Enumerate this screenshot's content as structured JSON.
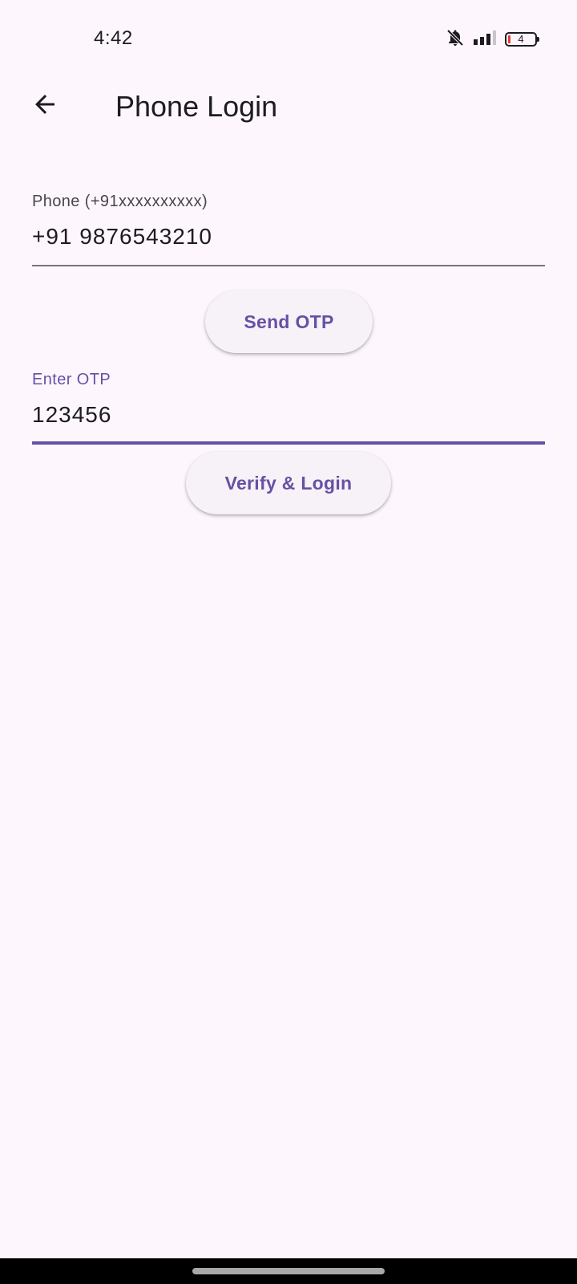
{
  "status_bar": {
    "time": "4:42",
    "battery_level": "4",
    "icons": [
      "notifications-off-icon",
      "signal-icon",
      "battery-icon"
    ]
  },
  "app_bar": {
    "title": "Phone Login",
    "back_icon": "arrow-back-icon"
  },
  "phone_field": {
    "label": "Phone (+91xxxxxxxxxx)",
    "value": "+91 9876543210"
  },
  "send_otp_button": {
    "label": "Send OTP"
  },
  "otp_field": {
    "label": "Enter OTP",
    "value": "123456"
  },
  "verify_button": {
    "label": "Verify & Login"
  },
  "colors": {
    "background": "#fdf7fd",
    "primary": "#6750a4",
    "on_surface": "#1d1b20",
    "button_surface": "#f6f2f7",
    "battery_low": "#e53935"
  }
}
